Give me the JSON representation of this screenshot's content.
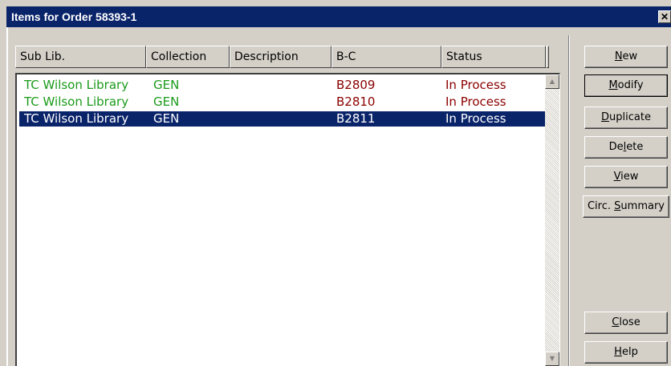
{
  "window": {
    "title": "Items for Order 58393-1",
    "close_glyph": "✕"
  },
  "table": {
    "columns": [
      "Sub Lib.",
      "Collection",
      "Description",
      "B-C",
      "Status"
    ],
    "rows": [
      {
        "sub_lib": "TC Wilson Library",
        "collection": "GEN",
        "description": "",
        "bc": "B2809",
        "status": "In Process",
        "selected": false
      },
      {
        "sub_lib": "TC Wilson Library",
        "collection": "GEN",
        "description": "",
        "bc": "B2810",
        "status": "In Process",
        "selected": false
      },
      {
        "sub_lib": "TC Wilson Library",
        "collection": "GEN",
        "description": "",
        "bc": "B2811",
        "status": "In Process",
        "selected": true
      }
    ]
  },
  "buttons": {
    "new": {
      "label": "New",
      "mnemonic": "N"
    },
    "modify": {
      "label": "Modify",
      "mnemonic": "M"
    },
    "duplicate": {
      "label": "Duplicate",
      "mnemonic": "D"
    },
    "delete": {
      "label": "Delete",
      "mnemonic": "l"
    },
    "view": {
      "label": "View",
      "mnemonic": "V"
    },
    "circ_summary": {
      "label": "Circ. Summary",
      "mnemonic": "S"
    },
    "close": {
      "label": "Close",
      "mnemonic": "C"
    },
    "help": {
      "label": "Help",
      "mnemonic": "H"
    }
  },
  "icons": {
    "scroll_up": "scroll-up-arrow-icon",
    "scroll_down": "scroll-down-arrow-icon",
    "close": "close-icon"
  },
  "colors": {
    "titlebar": "#0a246a",
    "selection": "#0a246a",
    "sub_lib_text": "#1a9a1a",
    "bc_status_text": "#8b0000"
  }
}
